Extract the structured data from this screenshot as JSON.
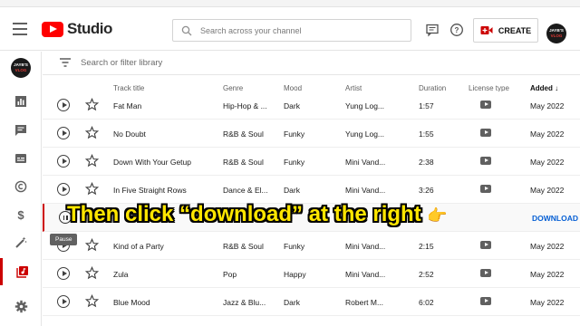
{
  "app": {
    "studio_label": "Studio",
    "create_label": "CREATE",
    "channel_avatar_text_1": "JAYB'S",
    "channel_avatar_text_2": "VLOG"
  },
  "search": {
    "placeholder": "Search across your channel"
  },
  "filter": {
    "placeholder": "Search or filter library"
  },
  "table": {
    "columns": {
      "track_title": "Track title",
      "genre": "Genre",
      "mood": "Mood",
      "artist": "Artist",
      "duration": "Duration",
      "license_type": "License type",
      "added": "Added"
    },
    "rows": [
      {
        "title": "Fat Man",
        "genre": "Hip-Hop & ...",
        "mood": "Dark",
        "artist": "Yung Log...",
        "duration": "1:57",
        "added": "May 2022"
      },
      {
        "title": "No Doubt",
        "genre": "R&B & Soul",
        "mood": "Funky",
        "artist": "Yung Log...",
        "duration": "1:55",
        "added": "May 2022"
      },
      {
        "title": "Down With Your Getup",
        "genre": "R&B & Soul",
        "mood": "Funky",
        "artist": "Mini Vand...",
        "duration": "2:38",
        "added": "May 2022"
      },
      {
        "title": "In Five Straight Rows",
        "genre": "Dance & El...",
        "mood": "Dark",
        "artist": "Mini Vand...",
        "duration": "3:26",
        "added": "May 2022"
      },
      {
        "title": "",
        "genre": "",
        "mood": "",
        "artist": "",
        "duration": "",
        "added": "",
        "action": "DOWNLOAD"
      },
      {
        "title": "Kind of a Party",
        "genre": "R&B & Soul",
        "mood": "Funky",
        "artist": "Mini Vand...",
        "duration": "2:15",
        "added": "May 2022"
      },
      {
        "title": "Zula",
        "genre": "Pop",
        "mood": "Happy",
        "artist": "Mini Vand...",
        "duration": "2:52",
        "added": "May 2022"
      },
      {
        "title": "Blue Mood",
        "genre": "Jazz & Blu...",
        "mood": "Dark",
        "artist": "Robert M...",
        "duration": "6:02",
        "added": "May 2022"
      }
    ]
  },
  "tooltip": {
    "text": "Pause"
  },
  "caption": {
    "text": "Then click “download” at the right",
    "emoji": "👉"
  },
  "colors": {
    "brand_red": "#ff0000",
    "accent_blue": "#065fd4",
    "caption_yellow": "#ffe600"
  }
}
